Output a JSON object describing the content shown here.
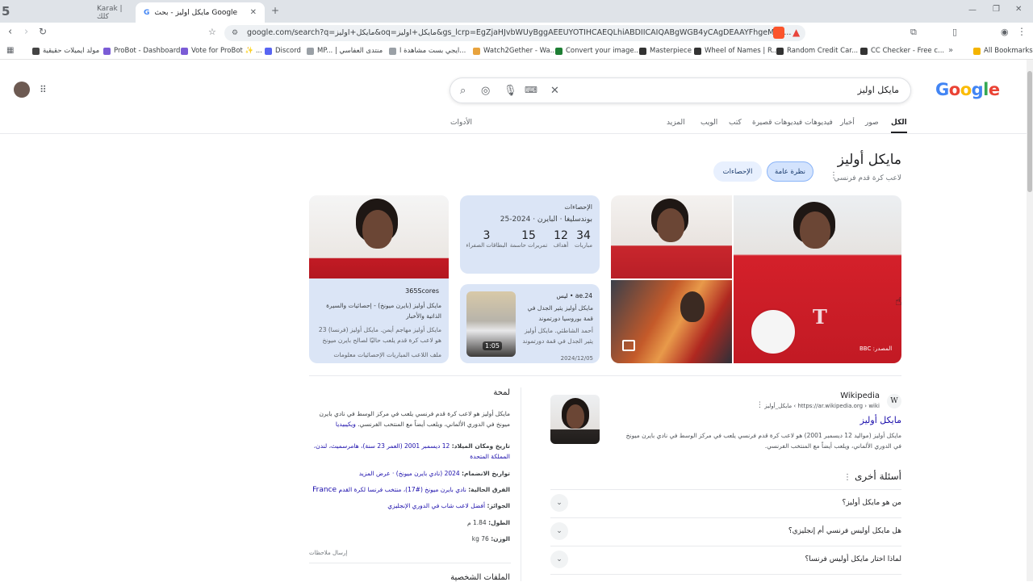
{
  "tabs": [
    {
      "title": "Karak | كلك",
      "active": false
    },
    {
      "title": "مايكل اوليز - بحث Google",
      "active": true
    }
  ],
  "omnibox": {
    "url": "google.com/search?q=مايكل+اوليز&oq=مايكل+اوليز&gs_lcrp=EgZjaHJvbWUyBggAEEUYOTIHCAEQLhiABDIICAIQABgWGB4yCAgDEAAYFhgeMgg..."
  },
  "bookmarks": [
    "مولد ايميلات حقيقية",
    "ProBot - Dashboard",
    "Vote for ProBot ✨ ...",
    "Discord",
    "MP... | منتدى العفاسي",
    "ايجي بست مشاهدة ا...",
    "Watch2Gether - Wa...",
    "Convert your image...",
    "Masterpiece",
    "Wheel of Names | R...",
    "Random Credit Car...",
    "CC Checker - Free c...",
    "All Bookmarks"
  ],
  "search": {
    "query": "مايكل اوليز",
    "logo": "Google"
  },
  "nav": {
    "all": "الكل",
    "images": "صور",
    "news": "أخبار",
    "videos": "فيديوهات",
    "shorts": "فيديوهات قصيرة",
    "books": "كتب",
    "web": "الويب",
    "more": "المزيد",
    "tools": "الأدوات"
  },
  "kp": {
    "title": "مايكل أوليز",
    "subtitle": "لاعب كرة قدم فرنسي",
    "chip_overview": "نظرة عامة",
    "chip_stats": "الإحصاءات",
    "image_credit": "المصدر: BBC"
  },
  "stats": {
    "heading": "الإحصاءات",
    "team": "بوندسليغا · البايرن · 2024-25",
    "items": [
      {
        "n": "34",
        "l": "مباريات"
      },
      {
        "n": "12",
        "l": "أهداف"
      },
      {
        "n": "15",
        "l": "تمريرات حاسمة"
      },
      {
        "n": "3",
        "l": "البطاقات الصفراء"
      }
    ]
  },
  "news": {
    "source": "24.ae • ليس",
    "text": "مايكل أوليز يثير الجدل في قمة بوروسيا دورتموند وبايرن...",
    "date": "2024/12/05",
    "duration": "1:05",
    "desc": "أحمد الشاطئي. مايكل أوليز يثير الجدل في قمة دورتموند وبايرن..."
  },
  "scores": {
    "source": "365Scores",
    "line1": "مايكل أوليز (بايرن ميونخ) - إحصائيات والسيرة الذاتية والأخبار",
    "line2": "مايكل أوليز مهاجم أيمن. مايكل أوليز (فرنسا) 23 هو لاعب كرة قدم يلعب حاليًا لصالح بايرن ميونخ في المانيا.",
    "line3": "ملف اللاعب المباريات الإحصائيات معلومات الانتقالات"
  },
  "overview": {
    "heading": "لمحة",
    "desc": "مايكل أوليز هو لاعب كرة قدم فرنسي يلعب في مركز الوسط في نادي بايرن ميونخ في الدوري الألماني، ويلعب أيضاً مع المنتخب الفرنسي.",
    "wiki_link": "ويكيبيديا",
    "born_label": "تاريخ ومكان الميلاد:",
    "born_value": "12 ديسمبر 2001 (العمر 23 سنة)، هامرسميث، لندن، المملكة المتحدة",
    "join_label": "تواريخ الانضمام:",
    "join_value": "2024 (نادي بايرن ميونخ) · عرض المزيد",
    "team_label": "الفرق الحالية:",
    "team_value": "نادي بايرن ميونخ (#17)، منتخب فرنسا لكرة القدم",
    "team_country": "France",
    "award_label": "الجوائز:",
    "award_value": "أفضل لاعب شاب في الدوري الإنجليزي",
    "height_label": "الطول:",
    "height_value": "1.84 م",
    "weight_label": "الوزن:",
    "weight_value": "76 kg",
    "feedback": "إرسال ملاحظات",
    "profiles": "الملفات الشخصية"
  },
  "wiki": {
    "name": "Wikipedia",
    "url": "https://ar.wikipedia.org › wiki › مايكل_أوليز",
    "title": "مايكل أوليز",
    "snippet": "مايكل أوليز (مواليد 12 ديسمبر 2001) هو لاعب كرة قدم فرنسي يلعب في مركز الوسط في نادي بايرن ميونخ في الدوري الألماني، ويلعب أيضاً مع المنتخب الفرنسي."
  },
  "faq": {
    "heading": "أسئلة أخرى",
    "items": [
      "من هو مايكل أوليز؟",
      "هل مايكل أوليس فرنسي أم إنجليزي؟",
      "لماذا اختار مايكل أوليس فرنسا؟"
    ]
  }
}
